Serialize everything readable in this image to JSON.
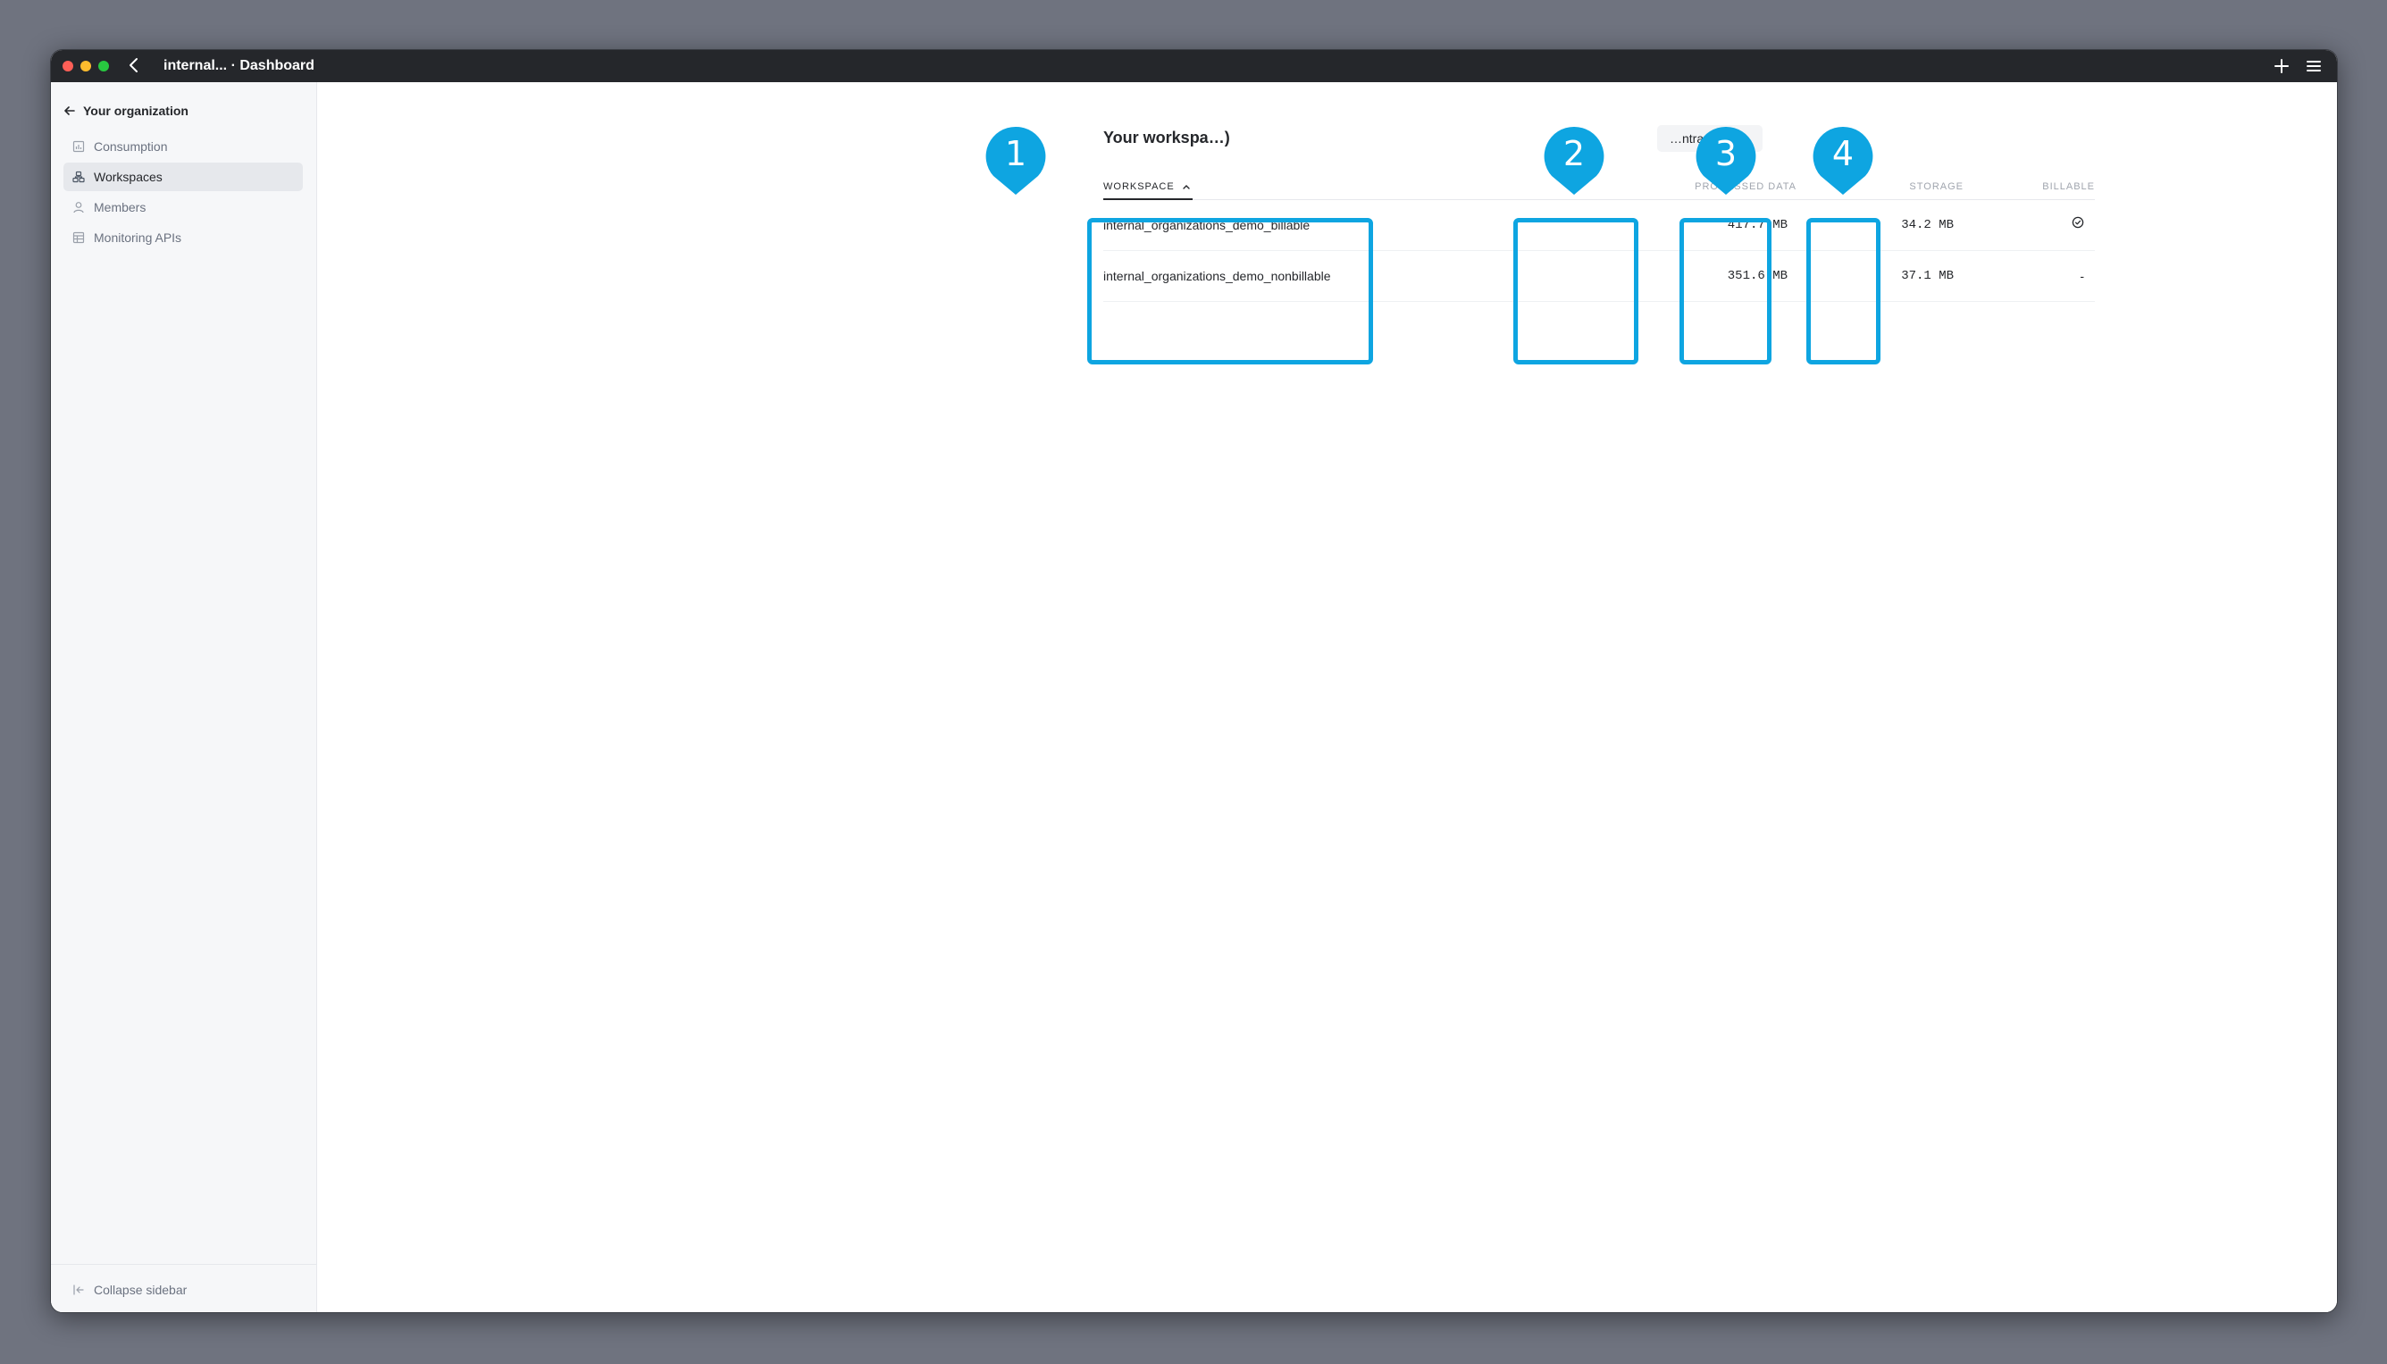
{
  "window": {
    "title": "internal... · Dashboard"
  },
  "sidebar": {
    "org_back_label": "Your organization",
    "items": [
      {
        "label": "Consumption",
        "icon": "chart-icon",
        "active": false
      },
      {
        "label": "Workspaces",
        "icon": "workspaces-icon",
        "active": true
      },
      {
        "label": "Members",
        "icon": "user-icon",
        "active": false
      },
      {
        "label": "Monitoring APIs",
        "icon": "table-icon",
        "active": false
      }
    ],
    "collapse_label": "Collapse sidebar"
  },
  "main": {
    "section_title": "Your workspa…)",
    "contract_button": "…ntract star…",
    "table": {
      "headers": {
        "workspace": "WORKSPACE",
        "processed_data": "PROCESSED DATA",
        "storage": "STORAGE",
        "billable": "BILLABLE"
      },
      "sort": {
        "column": "workspace",
        "direction": "asc"
      },
      "rows": [
        {
          "workspace": "internal_organizations_demo_billable",
          "processed_data": "417.7 MB",
          "storage": "34.2 MB",
          "billable": true,
          "billable_text": ""
        },
        {
          "workspace": "internal_organizations_demo_nonbillable",
          "processed_data": "351.6 MB",
          "storage": "37.1 MB",
          "billable": false,
          "billable_text": "-"
        }
      ]
    }
  },
  "callouts": [
    "1",
    "2",
    "3",
    "4"
  ],
  "colors": {
    "callout": "#0ea5e1",
    "titlebar": "#25272b",
    "desktop": "#6f737f"
  }
}
